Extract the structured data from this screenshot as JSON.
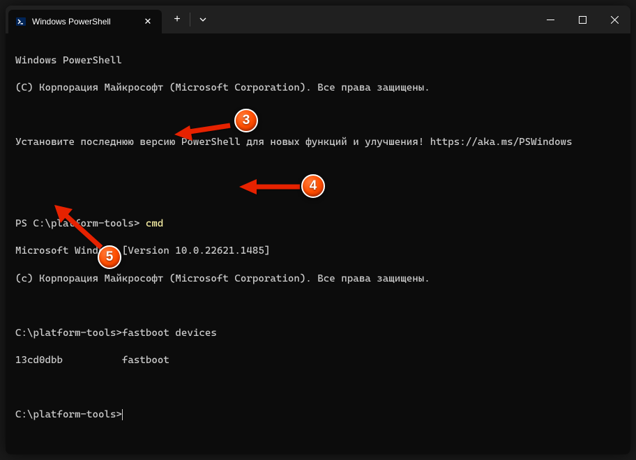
{
  "tab": {
    "title": "Windows PowerShell"
  },
  "terminal": {
    "line1": "Windows PowerShell",
    "line2": "(C) Корпорация Майкрософт (Microsoft Corporation). Все права защищены.",
    "line3": "Установите последнюю версию PowerShell для новых функций и улучшения! https://aka.ms/PSWindows",
    "ps_prompt": "PS C:\\platform-tools> ",
    "cmd_command": "cmd",
    "ms_version": "Microsoft Windows [Version 10.0.22621.1485]",
    "ms_copyright": "(c) Корпорация Майкрософт (Microsoft Corporation). Все права защищены.",
    "cmd_prompt1": "C:\\platform-tools>",
    "fastboot_cmd": "fastboot devices",
    "device_line": "13cd0dbb          fastboot",
    "cmd_prompt2": "C:\\platform-tools>"
  },
  "annotations": {
    "badge3": "3",
    "badge4": "4",
    "badge5": "5"
  }
}
